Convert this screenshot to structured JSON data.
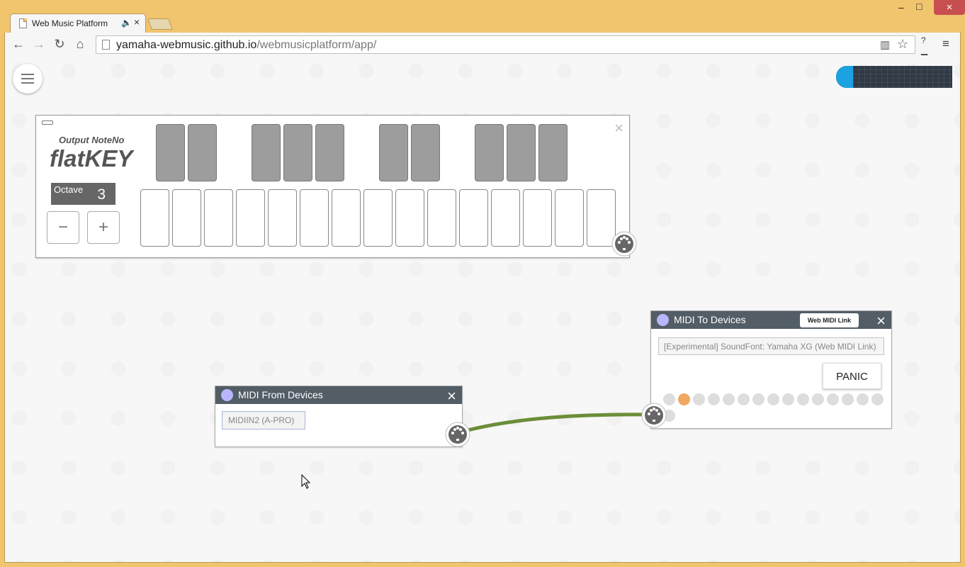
{
  "browser": {
    "tab_title": "Web Music Platform",
    "tab_close": "×",
    "url_host": "yamaha-webmusic.github.io",
    "url_path": "/webmusicplatform/app/",
    "minimize": "–",
    "maximize": "□",
    "close": "×",
    "extension_help": "?"
  },
  "flatkey": {
    "subtitle": "Output NoteNo",
    "logo": "flatKEY",
    "octave_label": "Octave",
    "octave_value": "3",
    "minus_label": "−",
    "plus_label": "+",
    "close_label": "×"
  },
  "midi_from": {
    "title": "MIDI From Devices",
    "close_label": "×",
    "device": "MIDIIN2 (A-PRO)"
  },
  "midi_to": {
    "title": "MIDI To Devices",
    "close_label": "×",
    "web_midi_link": "Web MIDI Link",
    "device": "[Experimental] SoundFont: Yamaha XG (Web MIDI Link)",
    "panic": "PANIC",
    "active_channel": 2,
    "channel_count": 16
  },
  "colors": {
    "connection": "#6b8e38",
    "node_header": "#525d66",
    "active_channel": "#f1a862",
    "meter_fill": "#1aa3e0"
  }
}
